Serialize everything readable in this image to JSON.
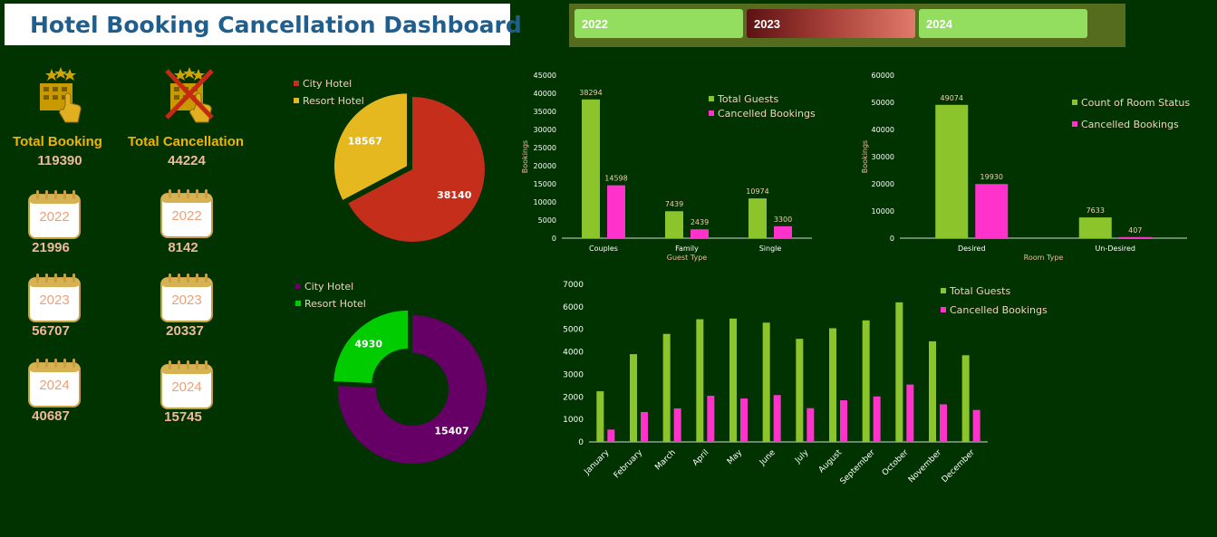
{
  "header": {
    "title": "Hotel Booking Cancellation Dashboard",
    "icon": "hotel-building-icon"
  },
  "year_slicer": {
    "items": [
      {
        "label": "2022",
        "selected": false
      },
      {
        "label": "2023",
        "selected": true
      },
      {
        "label": "2024",
        "selected": false
      }
    ]
  },
  "kpis": {
    "total_booking": {
      "label": "Total Booking",
      "value": "119390",
      "icon": "hotel-booking-icon"
    },
    "total_cancellation": {
      "label": "Total Cancellation",
      "value": "44224",
      "icon": "hotel-cancel-icon"
    },
    "booking_by_year": [
      {
        "year": "2022",
        "value": "21996"
      },
      {
        "year": "2023",
        "value": "56707"
      },
      {
        "year": "2024",
        "value": "40687"
      }
    ],
    "cancellation_by_year": [
      {
        "year": "2022",
        "value": "8142"
      },
      {
        "year": "2023",
        "value": "20337"
      },
      {
        "year": "2024",
        "value": "15745"
      }
    ]
  },
  "colors": {
    "background": "#003300",
    "green_series": "#8cc42b",
    "pink_series": "#ff33cc",
    "city_hotel_pie": "#c42e1b",
    "resort_hotel_pie": "#e6b820",
    "city_hotel_donut": "#660066",
    "resort_hotel_donut": "#00cc00",
    "label_text": "#f0b89a"
  },
  "chart_data": [
    {
      "type": "pie",
      "id": "pie-hotel-bookings",
      "categories": [
        "City Hotel",
        "Resort Hotel"
      ],
      "values": [
        38140,
        18567
      ],
      "legend": "top-left"
    },
    {
      "type": "pie",
      "variant": "donut",
      "id": "donut-hotel-cancellations",
      "categories": [
        "City Hotel",
        "Resort Hotel"
      ],
      "values": [
        15407,
        4930
      ],
      "legend": "top-left"
    },
    {
      "type": "bar",
      "id": "bar-guest-type",
      "categories": [
        "Couples",
        "Family",
        "Single"
      ],
      "series": [
        {
          "name": "Total Guests",
          "values": [
            38294,
            7439,
            10974
          ]
        },
        {
          "name": "Cancelled Bookings",
          "values": [
            14598,
            2439,
            3300
          ]
        }
      ],
      "xlabel": "Guest Type",
      "ylabel": "Bookings",
      "ylim": [
        0,
        45000
      ],
      "yticks": [
        0,
        5000,
        10000,
        15000,
        20000,
        25000,
        30000,
        35000,
        40000,
        45000
      ],
      "grid": false,
      "legend": "top-right"
    },
    {
      "type": "bar",
      "id": "bar-room-type",
      "categories": [
        "Desired",
        "Un-Desired"
      ],
      "series": [
        {
          "name": "Count of Room Status",
          "values": [
            49074,
            7633
          ]
        },
        {
          "name": "Cancelled Bookings",
          "values": [
            19930,
            407
          ]
        }
      ],
      "xlabel": "Room Type",
      "ylabel": "Bookings",
      "ylim": [
        0,
        60000
      ],
      "yticks": [
        0,
        10000,
        20000,
        30000,
        40000,
        50000,
        60000
      ],
      "grid": false,
      "legend": "top-right"
    },
    {
      "type": "bar",
      "id": "bar-monthly",
      "categories": [
        "January",
        "February",
        "March",
        "April",
        "May",
        "June",
        "July",
        "August",
        "September",
        "October",
        "November",
        "December"
      ],
      "series": [
        {
          "name": "Total Guests",
          "values": [
            2250,
            3900,
            4800,
            5450,
            5480,
            5300,
            4580,
            5050,
            5400,
            6200,
            4470,
            3850
          ]
        },
        {
          "name": "Cancelled Bookings",
          "values": [
            550,
            1330,
            1490,
            2050,
            1930,
            2080,
            1500,
            1850,
            2020,
            2550,
            1670,
            1420
          ]
        }
      ],
      "ylim": [
        0,
        7000
      ],
      "yticks": [
        0,
        1000,
        2000,
        3000,
        4000,
        5000,
        6000,
        7000
      ],
      "grid": false,
      "legend": "top-right"
    }
  ]
}
